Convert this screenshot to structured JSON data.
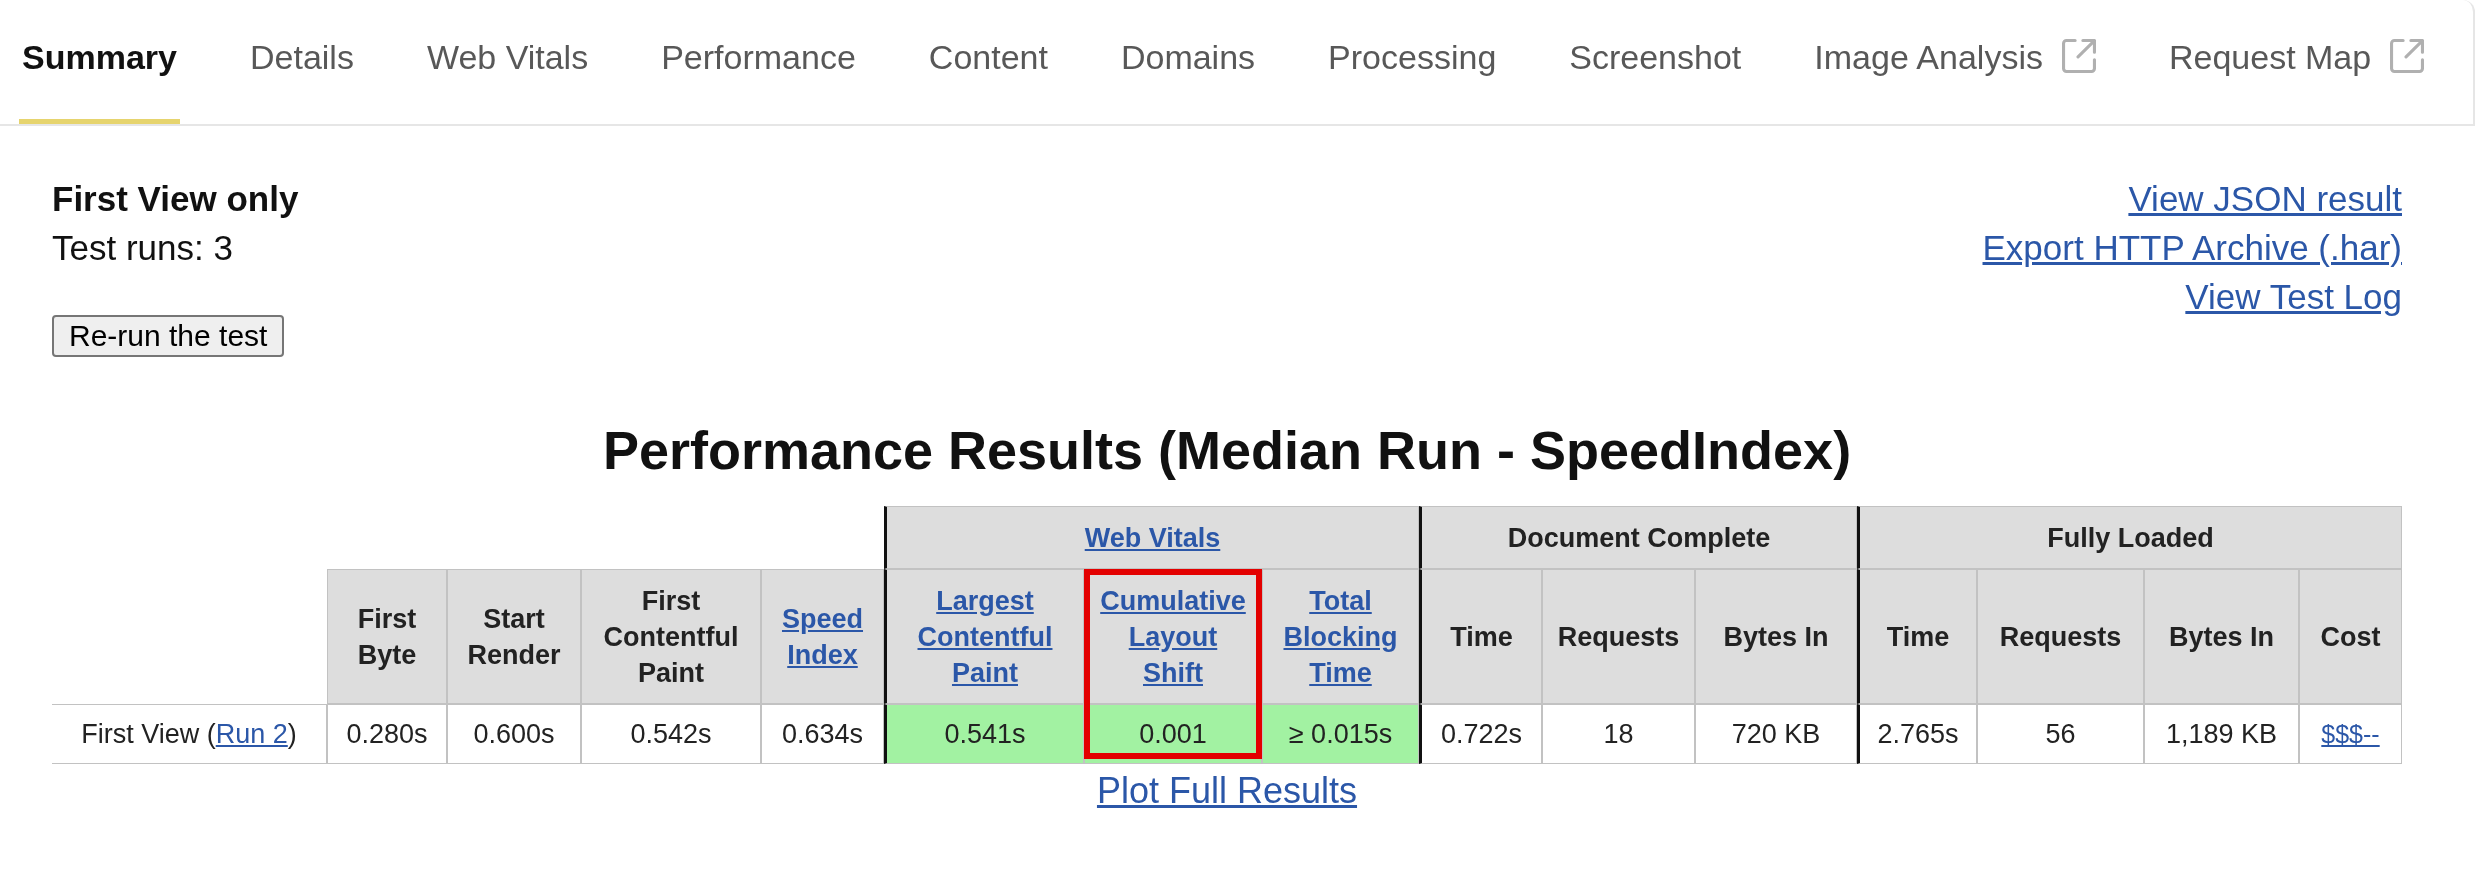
{
  "tabs": [
    {
      "label": "Summary",
      "selected": true,
      "external": false
    },
    {
      "label": "Details",
      "selected": false,
      "external": false
    },
    {
      "label": "Web Vitals",
      "selected": false,
      "external": false
    },
    {
      "label": "Performance",
      "selected": false,
      "external": false
    },
    {
      "label": "Content",
      "selected": false,
      "external": false
    },
    {
      "label": "Domains",
      "selected": false,
      "external": false
    },
    {
      "label": "Processing",
      "selected": false,
      "external": false
    },
    {
      "label": "Screenshot",
      "selected": false,
      "external": false
    },
    {
      "label": "Image Analysis",
      "selected": false,
      "external": true
    },
    {
      "label": "Request Map",
      "selected": false,
      "external": true
    }
  ],
  "summary": {
    "heading": "First View only",
    "test_runs": "Test runs: 3",
    "rerun_button": "Re-run the test",
    "links": [
      "View JSON result",
      "Export HTTP Archive (.har)",
      "View Test Log"
    ]
  },
  "results": {
    "title": "Performance Results (Median Run - SpeedIndex)",
    "table": {
      "column_groups": [
        {
          "columns": [
            {
              "label": "First Byte",
              "link": false,
              "highlighted": false
            },
            {
              "label": "Start Render",
              "link": false,
              "highlighted": false
            },
            {
              "label": "First Contentful Paint",
              "link": false,
              "highlighted": false
            },
            {
              "label": "Speed Index",
              "link": true,
              "highlighted": false
            }
          ]
        },
        {
          "title": "Web Vitals",
          "link": true,
          "columns": [
            {
              "label": "Largest Contentful Paint",
              "link": true,
              "highlighted": false
            },
            {
              "label": "Cumulative Layout Shift",
              "link": true,
              "highlighted": true
            },
            {
              "label": "Total Blocking Time",
              "link": true,
              "highlighted": false
            }
          ]
        },
        {
          "title": "Document Complete",
          "link": false,
          "columns": [
            {
              "label": "Time",
              "link": false,
              "highlighted": false
            },
            {
              "label": "Requests",
              "link": false,
              "highlighted": false
            },
            {
              "label": "Bytes In",
              "link": false,
              "highlighted": false
            }
          ]
        },
        {
          "title": "Fully Loaded",
          "link": false,
          "columns": [
            {
              "label": "Time",
              "link": false,
              "highlighted": false
            },
            {
              "label": "Requests",
              "link": false,
              "highlighted": false
            },
            {
              "label": "Bytes In",
              "link": false,
              "highlighted": false
            },
            {
              "label": "Cost",
              "link": false,
              "highlighted": false
            }
          ]
        }
      ],
      "rows": [
        {
          "label": "First View (",
          "run_link": "Run 2",
          "label_end": ")",
          "cells": [
            {
              "text": "0.280s",
              "good": false,
              "link": false
            },
            {
              "text": "0.600s",
              "good": false,
              "link": false
            },
            {
              "text": "0.542s",
              "good": false,
              "link": false
            },
            {
              "text": "0.634s",
              "good": false,
              "link": false
            },
            {
              "text": "0.541s",
              "good": true,
              "link": false
            },
            {
              "text": "0.001",
              "good": true,
              "link": false
            },
            {
              "text": "≥ 0.015s",
              "good": true,
              "link": false
            },
            {
              "text": "0.722s",
              "good": false,
              "link": false
            },
            {
              "text": "18",
              "good": false,
              "link": false
            },
            {
              "text": "720 KB",
              "good": false,
              "link": false
            },
            {
              "text": "2.765s",
              "good": false,
              "link": false
            },
            {
              "text": "56",
              "good": false,
              "link": false
            },
            {
              "text": "1,189 KB",
              "good": false,
              "link": false
            },
            {
              "text": "$$$--",
              "good": false,
              "link": true
            }
          ]
        }
      ]
    },
    "plot_link": "Plot Full Results"
  }
}
